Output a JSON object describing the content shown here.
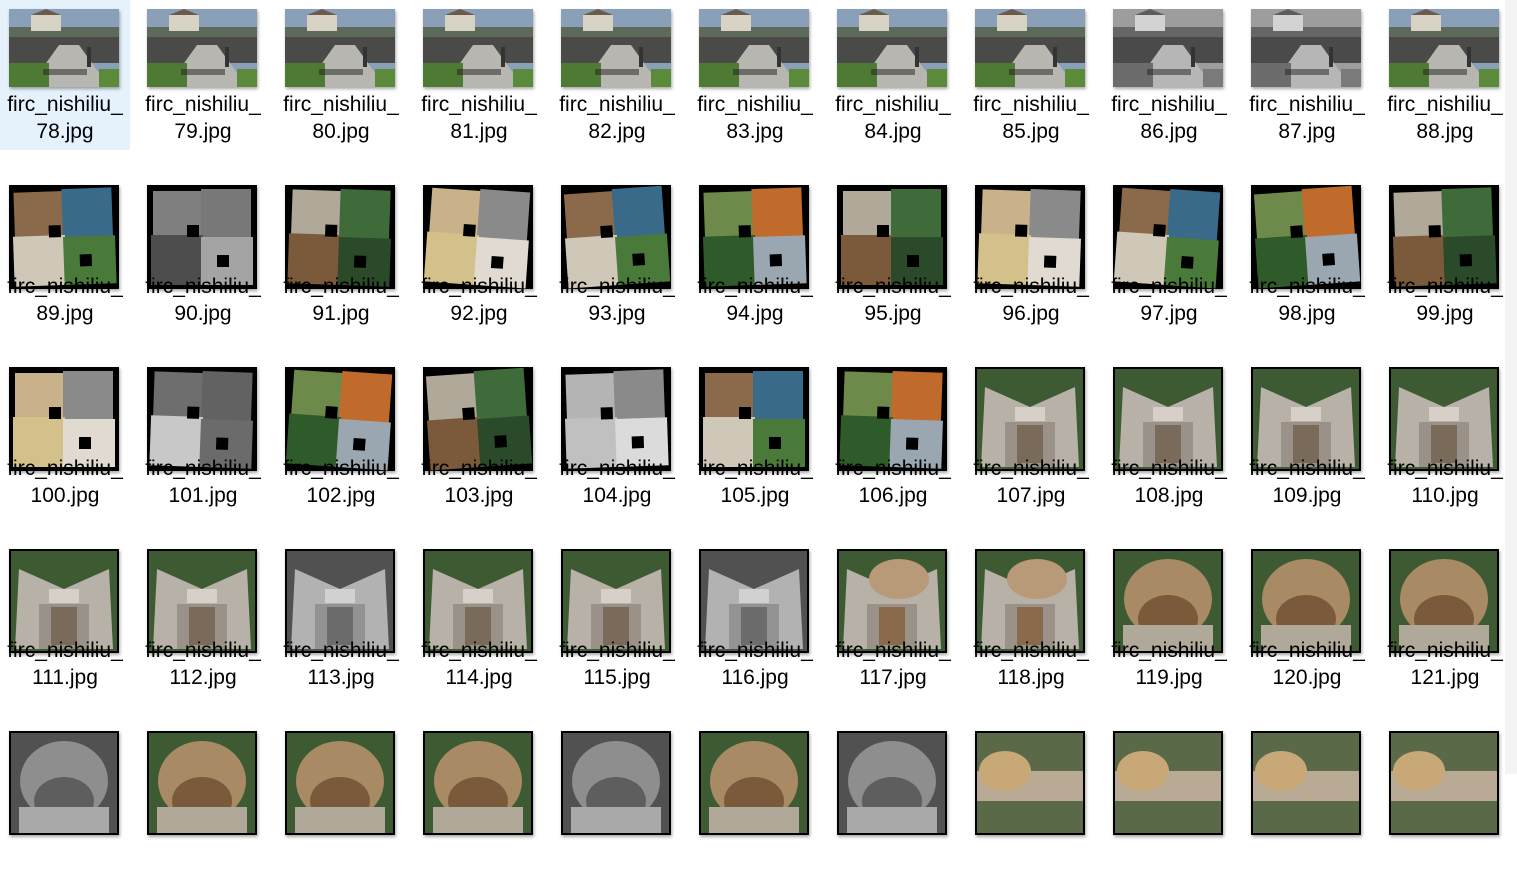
{
  "window": {
    "title": ""
  },
  "files": [
    {
      "line1": "firc_nishiliu_",
      "line2": "78.jpg",
      "kind": "road",
      "selected": true
    },
    {
      "line1": "firc_nishiliu_",
      "line2": "79.jpg",
      "kind": "road"
    },
    {
      "line1": "firc_nishiliu_",
      "line2": "80.jpg",
      "kind": "road"
    },
    {
      "line1": "firc_nishiliu_",
      "line2": "81.jpg",
      "kind": "road"
    },
    {
      "line1": "firc_nishiliu_",
      "line2": "82.jpg",
      "kind": "road"
    },
    {
      "line1": "firc_nishiliu_",
      "line2": "83.jpg",
      "kind": "road"
    },
    {
      "line1": "firc_nishiliu_",
      "line2": "84.jpg",
      "kind": "road"
    },
    {
      "line1": "firc_nishiliu_",
      "line2": "85.jpg",
      "kind": "road"
    },
    {
      "line1": "firc_nishiliu_",
      "line2": "86.jpg",
      "kind": "road-gray"
    },
    {
      "line1": "firc_nishiliu_",
      "line2": "87.jpg",
      "kind": "road-gray"
    },
    {
      "line1": "firc_nishiliu_",
      "line2": "88.jpg",
      "kind": "road"
    },
    {
      "line1": "firc_nishiliu_",
      "line2": "89.jpg",
      "kind": "collage"
    },
    {
      "line1": "firc_nishiliu_",
      "line2": "90.jpg",
      "kind": "collage-gray"
    },
    {
      "line1": "firc_nishiliu_",
      "line2": "91.jpg",
      "kind": "collage"
    },
    {
      "line1": "firc_nishiliu_",
      "line2": "92.jpg",
      "kind": "collage"
    },
    {
      "line1": "firc_nishiliu_",
      "line2": "93.jpg",
      "kind": "collage"
    },
    {
      "line1": "firc_nishiliu_",
      "line2": "94.jpg",
      "kind": "collage"
    },
    {
      "line1": "firc_nishiliu_",
      "line2": "95.jpg",
      "kind": "collage"
    },
    {
      "line1": "firc_nishiliu_",
      "line2": "96.jpg",
      "kind": "collage"
    },
    {
      "line1": "firc_nishiliu_",
      "line2": "97.jpg",
      "kind": "collage"
    },
    {
      "line1": "firc_nishiliu_",
      "line2": "98.jpg",
      "kind": "collage"
    },
    {
      "line1": "firc_nishiliu_",
      "line2": "99.jpg",
      "kind": "collage"
    },
    {
      "line1": "firc_nishiliu_",
      "line2": "100.jpg",
      "kind": "collage"
    },
    {
      "line1": "firc_nishiliu_",
      "line2": "101.jpg",
      "kind": "collage-gray"
    },
    {
      "line1": "firc_nishiliu_",
      "line2": "102.jpg",
      "kind": "collage"
    },
    {
      "line1": "firc_nishiliu_",
      "line2": "103.jpg",
      "kind": "collage"
    },
    {
      "line1": "firc_nishiliu_",
      "line2": "104.jpg",
      "kind": "collage-gray"
    },
    {
      "line1": "firc_nishiliu_",
      "line2": "105.jpg",
      "kind": "collage"
    },
    {
      "line1": "firc_nishiliu_",
      "line2": "106.jpg",
      "kind": "collage"
    },
    {
      "line1": "firc_nishiliu_",
      "line2": "107.jpg",
      "kind": "dam"
    },
    {
      "line1": "firc_nishiliu_",
      "line2": "108.jpg",
      "kind": "dam"
    },
    {
      "line1": "firc_nishiliu_",
      "line2": "109.jpg",
      "kind": "dam"
    },
    {
      "line1": "firc_nishiliu_",
      "line2": "110.jpg",
      "kind": "dam"
    },
    {
      "line1": "firc_nishiliu_",
      "line2": "111.jpg",
      "kind": "dam"
    },
    {
      "line1": "firc_nishiliu_",
      "line2": "112.jpg",
      "kind": "dam"
    },
    {
      "line1": "firc_nishiliu_",
      "line2": "113.jpg",
      "kind": "dam-gray"
    },
    {
      "line1": "firc_nishiliu_",
      "line2": "114.jpg",
      "kind": "dam"
    },
    {
      "line1": "firc_nishiliu_",
      "line2": "115.jpg",
      "kind": "dam"
    },
    {
      "line1": "firc_nishiliu_",
      "line2": "116.jpg",
      "kind": "dam-gray"
    },
    {
      "line1": "firc_nishiliu_",
      "line2": "117.jpg",
      "kind": "dam-flow"
    },
    {
      "line1": "firc_nishiliu_",
      "line2": "118.jpg",
      "kind": "dam-flow"
    },
    {
      "line1": "firc_nishiliu_",
      "line2": "119.jpg",
      "kind": "flow"
    },
    {
      "line1": "firc_nishiliu_",
      "line2": "120.jpg",
      "kind": "flow"
    },
    {
      "line1": "firc_nishiliu_",
      "line2": "121.jpg",
      "kind": "flow"
    },
    {
      "line1": "",
      "line2": "",
      "kind": "flow-gray"
    },
    {
      "line1": "",
      "line2": "",
      "kind": "flow"
    },
    {
      "line1": "",
      "line2": "",
      "kind": "flow"
    },
    {
      "line1": "",
      "line2": "",
      "kind": "flow"
    },
    {
      "line1": "",
      "line2": "",
      "kind": "flow-gray"
    },
    {
      "line1": "",
      "line2": "",
      "kind": "flow"
    },
    {
      "line1": "",
      "line2": "",
      "kind": "flow-gray"
    },
    {
      "line1": "",
      "line2": "",
      "kind": "wall"
    },
    {
      "line1": "",
      "line2": "",
      "kind": "wall"
    },
    {
      "line1": "",
      "line2": "",
      "kind": "wall"
    },
    {
      "line1": "",
      "line2": "",
      "kind": "wall"
    }
  ],
  "colors": {
    "selected_bg": "#e5f1fb",
    "text": "#000000"
  }
}
